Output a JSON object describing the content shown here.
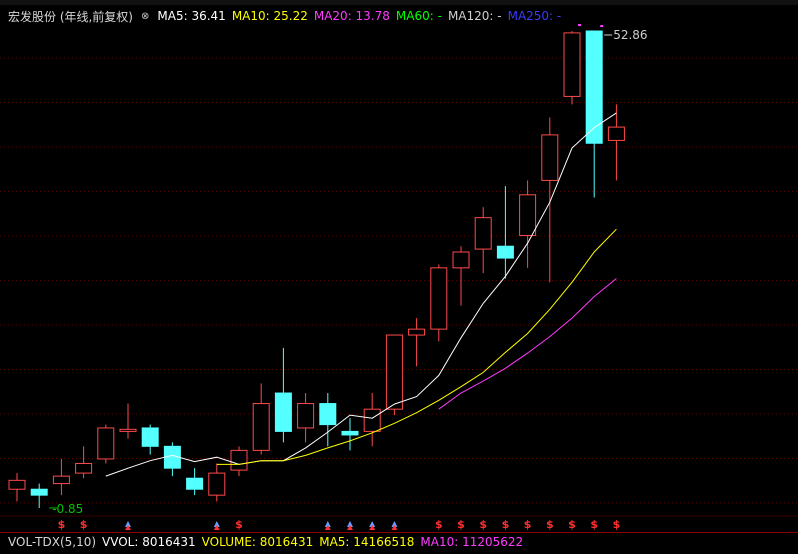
{
  "legend": {
    "title": "宏发股份 (年线,前复权)",
    "ma5": "MA5: 36.41",
    "ma10": "MA10: 25.22",
    "ma20": "MA20: 13.78",
    "ma60": "MA60: -",
    "ma120": "MA120: -",
    "ma250": "MA250: -"
  },
  "colors": {
    "up": "#ff4a4a",
    "down": "#54ffff",
    "ma5": "#ffffff",
    "ma10": "#ffff00",
    "ma20": "#ff3bff",
    "ma60": "#00ff00",
    "ma120": "#cfcfcf",
    "ma250": "#3a3aff",
    "grid": "#5a0000"
  },
  "labels": {
    "high": "52.86",
    "low": "0.85"
  },
  "volume_bar": {
    "name": "VOL-TDX(5,10)",
    "vvol": "VVOL: 8016431",
    "volume": "VOLUME: 8016431",
    "ma5": "MA5: 14166518",
    "ma10": "MA10: 11205622"
  },
  "chart_data": {
    "type": "candlestick",
    "y_scale": "log",
    "y_range": [
      0.85,
      52.86
    ],
    "candles": [
      {
        "o": 1.0,
        "h": 1.15,
        "l": 0.9,
        "c": 1.08
      },
      {
        "o": 1.0,
        "h": 1.05,
        "l": 0.85,
        "c": 0.95
      },
      {
        "o": 1.05,
        "h": 1.3,
        "l": 0.95,
        "c": 1.12
      },
      {
        "o": 1.15,
        "h": 1.45,
        "l": 1.1,
        "c": 1.25
      },
      {
        "o": 1.3,
        "h": 1.75,
        "l": 1.25,
        "c": 1.7
      },
      {
        "o": 1.65,
        "h": 2.1,
        "l": 1.55,
        "c": 1.68
      },
      {
        "o": 1.7,
        "h": 1.75,
        "l": 1.35,
        "c": 1.45
      },
      {
        "o": 1.45,
        "h": 1.5,
        "l": 1.12,
        "c": 1.2
      },
      {
        "o": 1.1,
        "h": 1.2,
        "l": 0.95,
        "c": 1.0
      },
      {
        "o": 0.95,
        "h": 1.25,
        "l": 0.9,
        "c": 1.15
      },
      {
        "o": 1.18,
        "h": 1.45,
        "l": 1.12,
        "c": 1.4
      },
      {
        "o": 1.4,
        "h": 2.5,
        "l": 1.35,
        "c": 2.1
      },
      {
        "o": 2.3,
        "h": 3.4,
        "l": 1.5,
        "c": 1.65
      },
      {
        "o": 1.7,
        "h": 2.3,
        "l": 1.5,
        "c": 2.1
      },
      {
        "o": 2.1,
        "h": 2.3,
        "l": 1.45,
        "c": 1.75
      },
      {
        "o": 1.65,
        "h": 1.85,
        "l": 1.4,
        "c": 1.6
      },
      {
        "o": 1.65,
        "h": 2.3,
        "l": 1.45,
        "c": 2.0
      },
      {
        "o": 2.0,
        "h": 3.8,
        "l": 1.9,
        "c": 3.8
      },
      {
        "o": 3.8,
        "h": 4.4,
        "l": 2.9,
        "c": 4.0
      },
      {
        "o": 4.0,
        "h": 7.0,
        "l": 3.6,
        "c": 6.8
      },
      {
        "o": 6.8,
        "h": 8.2,
        "l": 4.9,
        "c": 7.8
      },
      {
        "o": 8.0,
        "h": 11.5,
        "l": 6.5,
        "c": 10.5
      },
      {
        "o": 8.2,
        "h": 13.8,
        "l": 6.2,
        "c": 7.4
      },
      {
        "o": 9.0,
        "h": 14.5,
        "l": 6.8,
        "c": 12.8
      },
      {
        "o": 14.5,
        "h": 25.0,
        "l": 6.0,
        "c": 21.5
      },
      {
        "o": 30.0,
        "h": 52.86,
        "l": 28.0,
        "c": 52.0
      },
      {
        "o": 52.86,
        "h": 52.86,
        "l": 12.5,
        "c": 20.0
      },
      {
        "o": 20.5,
        "h": 28.0,
        "l": 14.5,
        "c": 23.0
      }
    ],
    "ma5": [
      null,
      null,
      null,
      null,
      1.12,
      1.2,
      1.28,
      1.34,
      1.27,
      1.32,
      1.24,
      1.28,
      1.28,
      1.43,
      1.64,
      1.9,
      1.85,
      2.09,
      2.23,
      2.68,
      3.71,
      5.0,
      6.32,
      8.42,
      12.0,
      19.2,
      22.9,
      26.0
    ],
    "ma10": [
      null,
      null,
      null,
      null,
      null,
      null,
      null,
      null,
      null,
      1.24,
      1.24,
      1.28,
      1.28,
      1.34,
      1.43,
      1.52,
      1.63,
      1.77,
      1.94,
      2.16,
      2.43,
      2.75,
      3.27,
      3.85,
      4.75,
      6.0,
      7.8,
      9.5
    ],
    "ma20": [
      null,
      null,
      null,
      null,
      null,
      null,
      null,
      null,
      null,
      null,
      null,
      null,
      null,
      null,
      null,
      null,
      null,
      null,
      null,
      2.0,
      2.3,
      2.55,
      2.85,
      3.25,
      3.75,
      4.4,
      5.3,
      6.2
    ],
    "volume_markers": [
      {
        "i": 2,
        "t": "S"
      },
      {
        "i": 3,
        "t": "S"
      },
      {
        "i": 5,
        "t": "A"
      },
      {
        "i": 9,
        "t": "A"
      },
      {
        "i": 10,
        "t": "S"
      },
      {
        "i": 14,
        "t": "A"
      },
      {
        "i": 15,
        "t": "A"
      },
      {
        "i": 16,
        "t": "A"
      },
      {
        "i": 17,
        "t": "A"
      },
      {
        "i": 19,
        "t": "S"
      },
      {
        "i": 20,
        "t": "S"
      },
      {
        "i": 21,
        "t": "S"
      },
      {
        "i": 22,
        "t": "S"
      },
      {
        "i": 23,
        "t": "S"
      },
      {
        "i": 24,
        "t": "S"
      },
      {
        "i": 25,
        "t": "S"
      },
      {
        "i": 26,
        "t": "S"
      },
      {
        "i": 27,
        "t": "S"
      }
    ]
  }
}
